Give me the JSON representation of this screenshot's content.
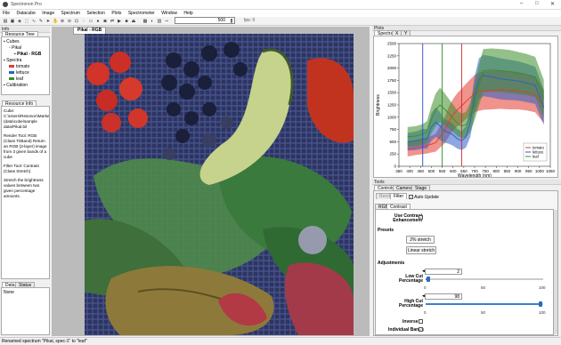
{
  "app": {
    "title": "Spectronon Pro"
  },
  "menu": [
    "File",
    "Datacube",
    "Image",
    "Spectrum",
    "Selection",
    "Plots",
    "Spectrometer",
    "Window",
    "Help"
  ],
  "toolbar": {
    "band_value": "500",
    "fps": "fps: 0"
  },
  "resource_tree": {
    "title": "Info",
    "tab": "Resource Tree",
    "cubes_label": "Cubes",
    "cube_name": "Pikal",
    "image_name": "Pikal - RGB",
    "spectra_label": "Spectra",
    "spectra": [
      {
        "name": "tomato",
        "color": "#e23b2e"
      },
      {
        "name": "lettuce",
        "color": "#2e5ec9"
      },
      {
        "name": "leaf",
        "color": "#3c8c2a"
      }
    ],
    "calibration_label": "Calibration"
  },
  "resource_info": {
    "tab": "Resource Info",
    "cube_line": "Cube: C:\\Users\\Resonon\\Marketing (data\\cube\\sample data\\Pikal.bil",
    "render_line": "Render Tool: RGB (Class TriBand) Return an RGB (3-layer) image from 3 given bands of a cube",
    "filter_line": "Filter Tool: Contrast (Class Stretch)",
    "stretch_line": "Stretch the brightness values between two given percentage amounts."
  },
  "data_panel": {
    "tab_data": "Data",
    "tab_status": "Status",
    "value": "None"
  },
  "image_window": {
    "tab": "Pikal - RGB"
  },
  "plots_panel": {
    "title": "Plots",
    "tab_spectra": "Spectra",
    "tab_x": "X",
    "tab_y": "Y"
  },
  "chart_data": {
    "type": "area",
    "xlabel": "Wavelength (nm)",
    "ylabel": "Brightness",
    "xlim": [
      350,
      1050
    ],
    "ylim": [
      0,
      2500
    ],
    "xticks": [
      350,
      400,
      450,
      500,
      550,
      600,
      650,
      700,
      750,
      800,
      850,
      900,
      950,
      1000,
      1050
    ],
    "yticks": [
      0,
      250,
      500,
      750,
      1000,
      1250,
      1500,
      1750,
      2000,
      2250,
      2500
    ],
    "x": [
      390,
      430,
      460,
      480,
      500,
      520,
      540,
      560,
      580,
      600,
      620,
      640,
      660,
      680,
      700,
      720,
      740,
      780,
      820,
      860,
      900,
      940,
      980,
      1020
    ],
    "series": [
      {
        "name": "tomato",
        "color": "#e23b2e",
        "values": [
          350,
          380,
          400,
          420,
          450,
          480,
          600,
          720,
          900,
          1050,
          1150,
          1230,
          1320,
          1400,
          1480,
          1520,
          1540,
          1550,
          1560,
          1550,
          1540,
          1510,
          1460,
          1220
        ],
        "band": [
          150,
          150,
          150,
          160,
          170,
          180,
          220,
          260,
          300,
          320,
          340,
          350,
          360,
          370,
          380,
          390,
          390,
          390,
          390,
          390,
          380,
          370,
          360,
          340
        ]
      },
      {
        "name": "lettuce",
        "color": "#2e5ec9",
        "values": [
          500,
          520,
          560,
          560,
          800,
          900,
          820,
          720,
          690,
          640,
          560,
          520,
          600,
          900,
          1450,
          1780,
          1850,
          1820,
          1780,
          1760,
          1740,
          1700,
          1650,
          1200
        ],
        "band": [
          180,
          190,
          200,
          200,
          280,
          300,
          280,
          240,
          230,
          220,
          200,
          190,
          220,
          300,
          380,
          420,
          420,
          420,
          420,
          410,
          400,
          390,
          380,
          360
        ]
      },
      {
        "name": "leaf",
        "color": "#3c8c2a",
        "values": [
          600,
          620,
          650,
          700,
          950,
          1150,
          1250,
          1170,
          1080,
          980,
          880,
          820,
          850,
          1000,
          1300,
          1650,
          1950,
          1960,
          1950,
          1930,
          1900,
          1870,
          1820,
          1380
        ],
        "band": [
          200,
          200,
          210,
          220,
          280,
          330,
          350,
          330,
          300,
          280,
          260,
          250,
          260,
          300,
          360,
          420,
          440,
          440,
          440,
          440,
          430,
          420,
          410,
          380
        ]
      }
    ],
    "markers": [
      {
        "x": 460,
        "color": "#2a4bd0"
      },
      {
        "x": 550,
        "color": "#2e8c2a"
      },
      {
        "x": 640,
        "color": "#d02a2a"
      }
    ],
    "legend_position": "bottom-right",
    "grid": false
  },
  "tools": {
    "title": "Tools",
    "tabs": [
      "Controls",
      "Camera",
      "Stage"
    ],
    "subtabs": [
      "Render",
      "Filter"
    ],
    "auto_update": "Auto Update",
    "inner_tabs": [
      "RGB",
      "Contrast"
    ],
    "use_contrast_label": "Use Contrast Enhancement",
    "presets_label": "Presets",
    "preset_1": "2% stretch",
    "preset_2": "Linear stretch",
    "adjustments_label": "Adjustments",
    "low_cut_label": "Low Cut Percentage",
    "low_cut_value": "2",
    "low_cut_level": 0.02,
    "high_cut_label": "High Cut Percentage",
    "high_cut_value": "98",
    "high_cut_level": 0.98,
    "ticks": [
      "0",
      "50",
      "100"
    ],
    "inverse_label": "Inverse",
    "individual_bands_label": "Individual Bands"
  },
  "status_bar": {
    "message": "Renamed spectrum \"Pikal, spec-1\" to \"leaf\""
  }
}
